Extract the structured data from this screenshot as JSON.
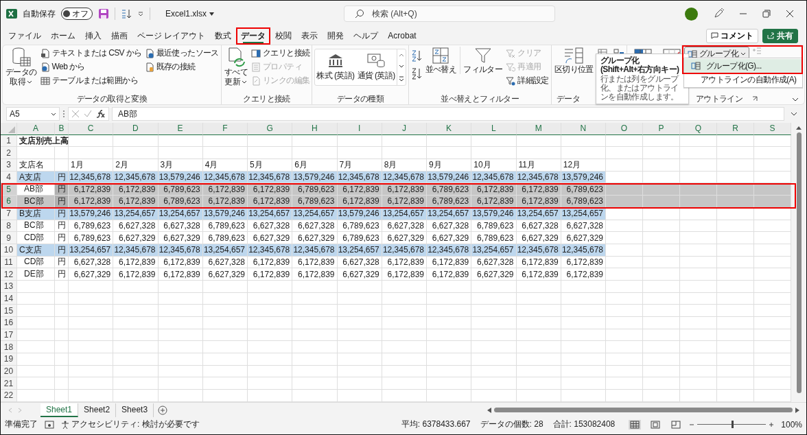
{
  "titlebar": {
    "autosave": {
      "label": "自動保存",
      "state_label": "オフ",
      "on": false
    },
    "filename": "Excel1.xlsx",
    "search_placeholder": "検索 (Alt+Q)"
  },
  "tabs": [
    {
      "label": "ファイル",
      "selected": false,
      "highlighted": false
    },
    {
      "label": "ホーム",
      "selected": false,
      "highlighted": false
    },
    {
      "label": "挿入",
      "selected": false,
      "highlighted": false
    },
    {
      "label": "描画",
      "selected": false,
      "highlighted": false
    },
    {
      "label": "ページ レイアウト",
      "selected": false,
      "highlighted": false
    },
    {
      "label": "数式",
      "selected": false,
      "highlighted": false
    },
    {
      "label": "データ",
      "selected": true,
      "highlighted": true
    },
    {
      "label": "校閲",
      "selected": false,
      "highlighted": false
    },
    {
      "label": "表示",
      "selected": false,
      "highlighted": false
    },
    {
      "label": "開発",
      "selected": false,
      "highlighted": false
    },
    {
      "label": "ヘルプ",
      "selected": false,
      "highlighted": false
    },
    {
      "label": "Acrobat",
      "selected": false,
      "highlighted": false
    }
  ],
  "comment_button": "コメント",
  "share_button": "共有",
  "ribbon": {
    "groups": [
      {
        "kind": "get_data",
        "label": "データの取得と変換",
        "main": [
          "データの",
          "取得"
        ],
        "columns": [
          [
            {
              "label": "テキストまたは CSV から",
              "disabled": false
            },
            {
              "label": "Web から",
              "disabled": false
            },
            {
              "label": "テーブルまたは範囲から",
              "disabled": false
            }
          ],
          [
            {
              "label": "最近使ったソース",
              "disabled": false
            },
            {
              "label": "既存の接続",
              "disabled": false
            }
          ]
        ]
      },
      {
        "kind": "query",
        "label": "クエリと接続",
        "main": [
          "すべて",
          "更新"
        ],
        "columns": [
          [
            {
              "label": "クエリと接続",
              "disabled": false
            },
            {
              "label": "プロパティ",
              "disabled": true
            },
            {
              "label": "リンクの編集",
              "disabled": true
            }
          ]
        ]
      },
      {
        "kind": "types",
        "label": "データの種類",
        "items": [
          "株式 (英語)",
          "通貨 (英語)"
        ]
      },
      {
        "kind": "sort",
        "label": "並べ替えとフィルター",
        "sort": "並べ替え",
        "filter": "フィルター",
        "columns": [
          [
            {
              "label": "クリア",
              "disabled": true
            },
            {
              "label": "再適用",
              "disabled": true
            },
            {
              "label": "詳細設定",
              "disabled": false
            }
          ]
        ]
      },
      {
        "kind": "tools",
        "label": "データ",
        "main": [
          "区切り位置"
        ]
      },
      {
        "kind": "forecast"
      },
      {
        "kind": "outline",
        "label": "アウトライン",
        "button": "グループ化",
        "highlighted": true
      }
    ]
  },
  "tooltip": {
    "title": "グループ化 (Shift+Alt+右方向キー)",
    "text": "行または列をグループ化、またはアウトラインを自動作成します。"
  },
  "menu": [
    {
      "label": "グループ化(G)...",
      "selected": true
    },
    {
      "label": "アウトラインの自動作成(A)",
      "selected": false
    }
  ],
  "formula_bar": {
    "name_box": "A5",
    "formula": "AB部"
  },
  "sheet": {
    "columns": [
      "A",
      "B",
      "C",
      "D",
      "E",
      "F",
      "G",
      "H",
      "I",
      "J",
      "K",
      "L",
      "M",
      "N",
      "O",
      "P",
      "Q",
      "R",
      "S"
    ],
    "highlight_selection": true,
    "rows": [
      {
        "number": "1",
        "kind": "title",
        "selected": false,
        "label": "支店別売上高"
      },
      {
        "number": "2",
        "kind": "empty",
        "selected": false
      },
      {
        "number": "3",
        "kind": "header",
        "selected": false,
        "label": "支店名",
        "values": [
          "1月",
          "2月",
          "3月",
          "4月",
          "5月",
          "6月",
          "7月",
          "8月",
          "9月",
          "10月",
          "11月",
          "12月"
        ]
      },
      {
        "number": "4",
        "kind": "branch",
        "selected": false,
        "label": "A支店",
        "unit": "円",
        "values": [
          "12,345,678",
          "12,345,678",
          "13,579,246",
          "12,345,678",
          "12,345,678",
          "13,579,246",
          "12,345,678",
          "12,345,678",
          "13,579,246",
          "12,345,678",
          "12,345,678",
          "13,579,246"
        ]
      },
      {
        "number": "5",
        "kind": "dept",
        "selected": true,
        "label": "AB部",
        "unit": "円",
        "values": [
          "6,172,839",
          "6,172,839",
          "6,789,623",
          "6,172,839",
          "6,172,839",
          "6,789,623",
          "6,172,839",
          "6,172,839",
          "6,789,623",
          "6,172,839",
          "6,172,839",
          "6,789,623"
        ]
      },
      {
        "number": "6",
        "kind": "dept",
        "selected": true,
        "label": "BC部",
        "unit": "円",
        "values": [
          "6,172,839",
          "6,172,839",
          "6,789,623",
          "6,172,839",
          "6,172,839",
          "6,789,623",
          "6,172,839",
          "6,172,839",
          "6,789,623",
          "6,172,839",
          "6,172,839",
          "6,789,623"
        ]
      },
      {
        "number": "7",
        "kind": "branch",
        "selected": false,
        "label": "B支店",
        "unit": "円",
        "values": [
          "13,579,246",
          "13,254,657",
          "13,254,657",
          "13,579,246",
          "13,254,657",
          "13,254,657",
          "13,579,246",
          "13,254,657",
          "13,254,657",
          "13,579,246",
          "13,254,657",
          "13,254,657"
        ]
      },
      {
        "number": "8",
        "kind": "dept",
        "selected": false,
        "label": "BC部",
        "unit": "円",
        "values": [
          "6,789,623",
          "6,627,328",
          "6,627,328",
          "6,789,623",
          "6,627,328",
          "6,627,328",
          "6,789,623",
          "6,627,328",
          "6,627,328",
          "6,789,623",
          "6,627,328",
          "6,627,328"
        ]
      },
      {
        "number": "9",
        "kind": "dept",
        "selected": false,
        "label": "CD部",
        "unit": "円",
        "values": [
          "6,789,623",
          "6,627,329",
          "6,627,329",
          "6,789,623",
          "6,627,329",
          "6,627,329",
          "6,789,623",
          "6,627,329",
          "6,627,329",
          "6,789,623",
          "6,627,329",
          "6,627,329"
        ]
      },
      {
        "number": "10",
        "kind": "branch",
        "selected": false,
        "label": "C支店",
        "unit": "円",
        "values": [
          "13,254,657",
          "12,345,678",
          "12,345,678",
          "13,254,657",
          "12,345,678",
          "12,345,678",
          "13,254,657",
          "12,345,678",
          "12,345,678",
          "13,254,657",
          "12,345,678",
          "12,345,678"
        ]
      },
      {
        "number": "11",
        "kind": "dept",
        "selected": false,
        "label": "CD部",
        "unit": "円",
        "values": [
          "6,627,328",
          "6,172,839",
          "6,172,839",
          "6,627,328",
          "6,172,839",
          "6,172,839",
          "6,627,328",
          "6,172,839",
          "6,172,839",
          "6,627,328",
          "6,172,839",
          "6,172,839"
        ]
      },
      {
        "number": "12",
        "kind": "dept",
        "selected": false,
        "label": "DE部",
        "unit": "円",
        "values": [
          "6,627,329",
          "6,172,839",
          "6,172,839",
          "6,627,329",
          "6,172,839",
          "6,172,839",
          "6,627,329",
          "6,172,839",
          "6,172,839",
          "6,627,329",
          "6,172,839",
          "6,172,839"
        ]
      },
      {
        "number": "13",
        "kind": "empty",
        "selected": false
      },
      {
        "number": "14",
        "kind": "empty",
        "selected": false
      },
      {
        "number": "15",
        "kind": "empty",
        "selected": false
      },
      {
        "number": "16",
        "kind": "empty",
        "selected": false
      },
      {
        "number": "17",
        "kind": "empty",
        "selected": false
      },
      {
        "number": "18",
        "kind": "empty",
        "selected": false
      },
      {
        "number": "19",
        "kind": "empty",
        "selected": false
      },
      {
        "number": "20",
        "kind": "empty",
        "selected": false
      },
      {
        "number": "21",
        "kind": "empty",
        "selected": false
      },
      {
        "number": "22",
        "kind": "empty",
        "selected": false
      }
    ]
  },
  "sheet_tabs": [
    {
      "label": "Sheet1",
      "selected": true
    },
    {
      "label": "Sheet2",
      "selected": false
    },
    {
      "label": "Sheet3",
      "selected": false
    }
  ],
  "status": {
    "ready": "準備完了",
    "accessibility": "アクセシビリティ: 検討が必要です",
    "stats": [
      "平均: 6378433.667",
      "データの個数: 28",
      "合計: 153082408"
    ],
    "views": [
      {
        "kind": "normal",
        "selected": true
      },
      {
        "kind": "page_layout",
        "selected": false
      },
      {
        "kind": "page_break",
        "selected": false
      }
    ],
    "zoom": {
      "level": 0.5,
      "label": "100%"
    }
  }
}
